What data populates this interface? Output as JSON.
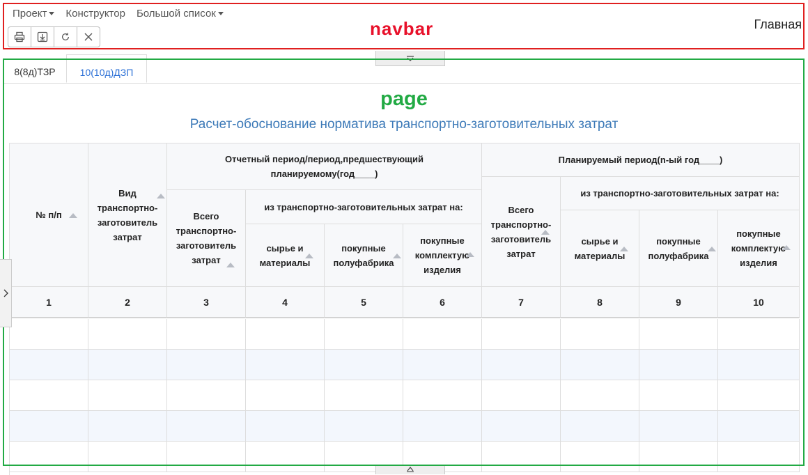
{
  "navbar": {
    "menu": [
      {
        "label": "Проект",
        "dropdown": true
      },
      {
        "label": "Конструктор",
        "dropdown": false
      },
      {
        "label": "Большой список",
        "dropdown": true
      }
    ],
    "toolbar": [
      "print-icon",
      "download-icon",
      "refresh-icon",
      "close-icon"
    ],
    "section_label": "navbar",
    "home_link": "Главная"
  },
  "tabs": [
    {
      "label": "8(8д)ТЗР",
      "active": false
    },
    {
      "label": "10(10д)ДЗП",
      "active": true
    }
  ],
  "page": {
    "section_label": "page",
    "title": "Расчет-обоснование норматива транспортно-заготовительных затрат"
  },
  "table": {
    "headers": {
      "col1": "№ п/п",
      "col2": "Вид транспортно-заготовитель затрат",
      "group_reported": "Отчетный период/период,предшествующий планируемому(год____)",
      "group_planned": "Планируемый период(n-ый год____)",
      "total": "Всего транспортно-заготовитель затрат",
      "sub_group": "из транспортно-заготовительных затрат на:",
      "raw": "сырье и материалы",
      "semi": "покупные полуфабрика",
      "kits": "покупные комплектую изделия"
    },
    "column_numbers": [
      "1",
      "2",
      "3",
      "4",
      "5",
      "6",
      "7",
      "8",
      "9",
      "10"
    ],
    "rows": [
      [],
      [],
      [],
      [],
      []
    ]
  },
  "colors": {
    "navbar_border": "#e02020",
    "page_border": "#22aa44",
    "title": "#3d7ab8",
    "active_tab": "#2a6fd6",
    "row_alt": "#f3f7fd"
  }
}
